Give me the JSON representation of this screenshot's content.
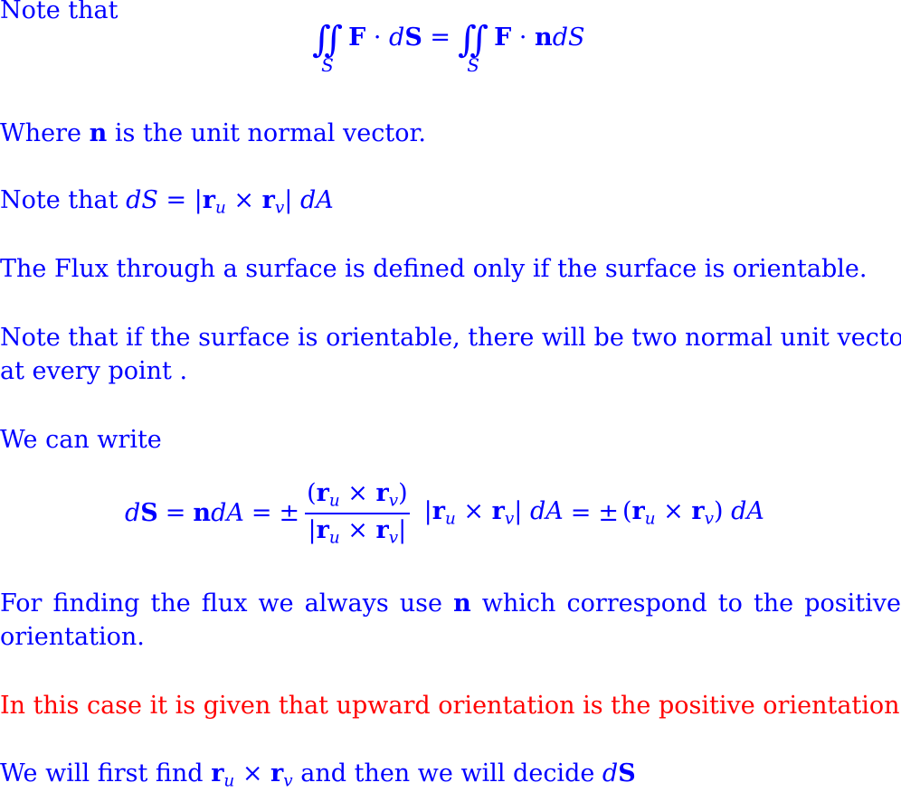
{
  "colors": {
    "text": "#0000ff",
    "highlight": "#ff0000"
  },
  "lines": {
    "note1": "Note that",
    "where_prefix": "Where ",
    "where_n": "n",
    "where_suffix": " is the unit normal vector.",
    "note_ds_prefix": "Note that ",
    "flux_defined": "The Flux through a surface is defined only if the surface is orientable.",
    "two_normals_1": "Note that if the surface is orientable, there will be two normal unit vectors",
    "two_normals_2": "at every point .",
    "we_can_write": "We can write",
    "finding_flux_1_prefix": "For finding the flux we always use",
    "finding_flux_1_n": "n",
    "finding_flux_1_suffix": "which correspond to the positive",
    "finding_flux_2": "orientation.",
    "upward": "In this case it is given that upward orientation is the positive orientation.",
    "final_prefix": "We will first find ",
    "final_middle": " and then we will decide "
  },
  "equations": {
    "surface_integral": {
      "lhs_integrand_F": "F",
      "dot": "·",
      "lhs_d": "d",
      "lhs_S": "S",
      "equals": "=",
      "rhs_n": "n",
      "rhs_dS": "dS",
      "sub_S": "S",
      "integral": "∬"
    },
    "dS_def": {
      "d": "dS",
      "equals": "=",
      "abs_open": "|",
      "r": "r",
      "u": "u",
      "times": "×",
      "v": "v",
      "abs_close": "|",
      "dA": "dA"
    },
    "dS_expansion": {
      "d": "d",
      "S": "S",
      "eq1": "=",
      "n": "n",
      "dA": "dA",
      "eq2": "=",
      "pm": "±",
      "num": "(r_u × r_v)",
      "den": "|r_u × r_v|",
      "eq3": "=",
      "pm2": "±"
    }
  }
}
